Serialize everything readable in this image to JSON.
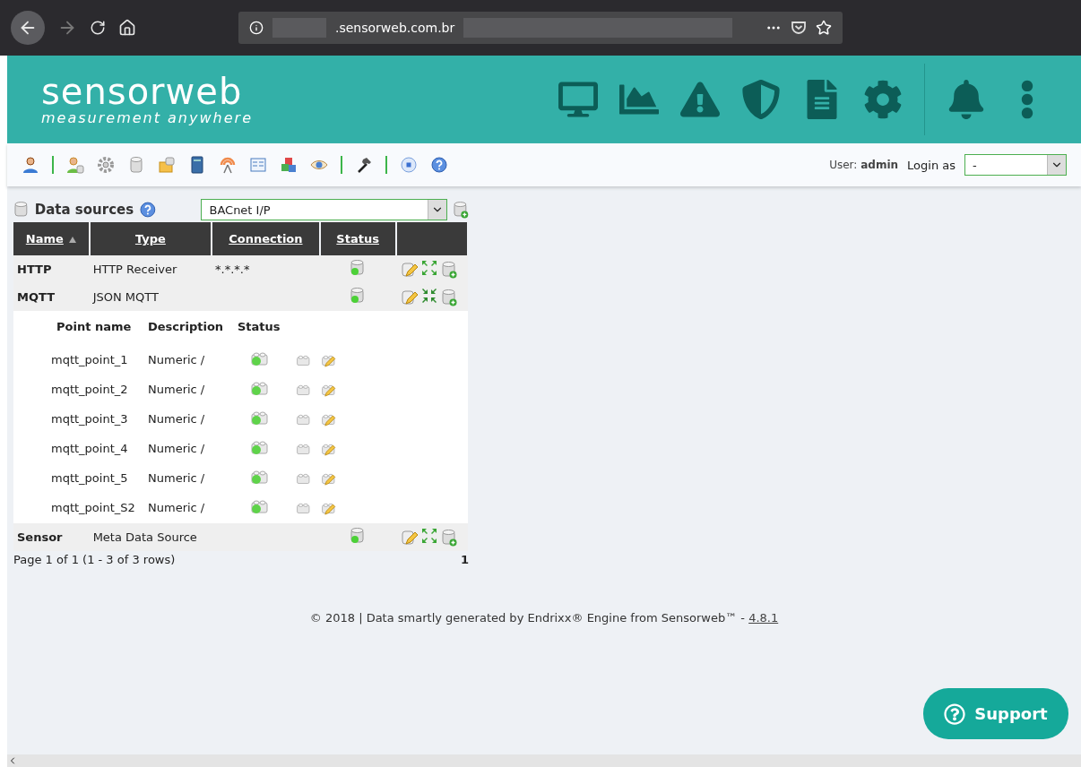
{
  "browser": {
    "url": ".sensorweb.com.br"
  },
  "header": {
    "logo": "sensorweb",
    "tagline": "measurement anywhere",
    "icons": [
      {
        "kind": "monitor"
      },
      {
        "kind": "chart"
      },
      {
        "kind": "warning"
      },
      {
        "kind": "shield"
      },
      {
        "kind": "document"
      },
      {
        "kind": "gear"
      },
      {
        "kind": "bell"
      },
      {
        "kind": "menu"
      }
    ]
  },
  "toolbar": {
    "items": [
      {
        "kind": "user"
      },
      {
        "kind": "separator"
      },
      {
        "kind": "user-db"
      },
      {
        "kind": "gear"
      },
      {
        "kind": "database"
      },
      {
        "kind": "folder"
      },
      {
        "kind": "book"
      },
      {
        "kind": "antenna"
      },
      {
        "kind": "form"
      },
      {
        "kind": "cubes"
      },
      {
        "kind": "eye"
      },
      {
        "kind": "separator"
      },
      {
        "kind": "hammer"
      },
      {
        "kind": "separator"
      },
      {
        "kind": "stop"
      },
      {
        "kind": "help"
      }
    ],
    "user_label": "User:",
    "user": "admin",
    "login_as_label": "Login as",
    "login_as": "-"
  },
  "data_sources": {
    "title": "Data sources",
    "type_select": "BACnet I/P",
    "columns": [
      {
        "label": "Name",
        "sorted": true
      },
      {
        "label": "Type",
        "sorted": false
      },
      {
        "label": "Connection",
        "sorted": false
      },
      {
        "label": "Status",
        "sorted": false
      }
    ],
    "rows": [
      {
        "name": "HTTP",
        "type": "HTTP Receiver",
        "connection": "*.*.*.*",
        "enabled": true,
        "expanded": false
      },
      {
        "name": "MQTT",
        "type": "JSON MQTT",
        "enabled": true,
        "expanded": true,
        "points_columns": [
          "Point name",
          "Description",
          "Status"
        ],
        "points": [
          {
            "name": "mqtt_point_1",
            "description": "Numeric /",
            "enabled": true
          },
          {
            "name": "mqtt_point_2",
            "description": "Numeric /",
            "enabled": true
          },
          {
            "name": "mqtt_point_3",
            "description": "Numeric /",
            "enabled": true
          },
          {
            "name": "mqtt_point_4",
            "description": "Numeric /",
            "enabled": true
          },
          {
            "name": "mqtt_point_5",
            "description": "Numeric /",
            "enabled": true
          },
          {
            "name": "mqtt_point_S2",
            "description": "Numeric /",
            "enabled": true
          }
        ]
      },
      {
        "name": "Sensor",
        "type": "Meta Data Source",
        "enabled": true,
        "expanded": false
      }
    ],
    "pagination": "Page 1 of 1 (1 - 3 of 3 rows)",
    "page": "1"
  },
  "footer": {
    "text": "© 2018 | Data smartly generated by Endrixx® Engine from Sensorweb™ -",
    "version": "4.8.1"
  },
  "support_button": "Support"
}
